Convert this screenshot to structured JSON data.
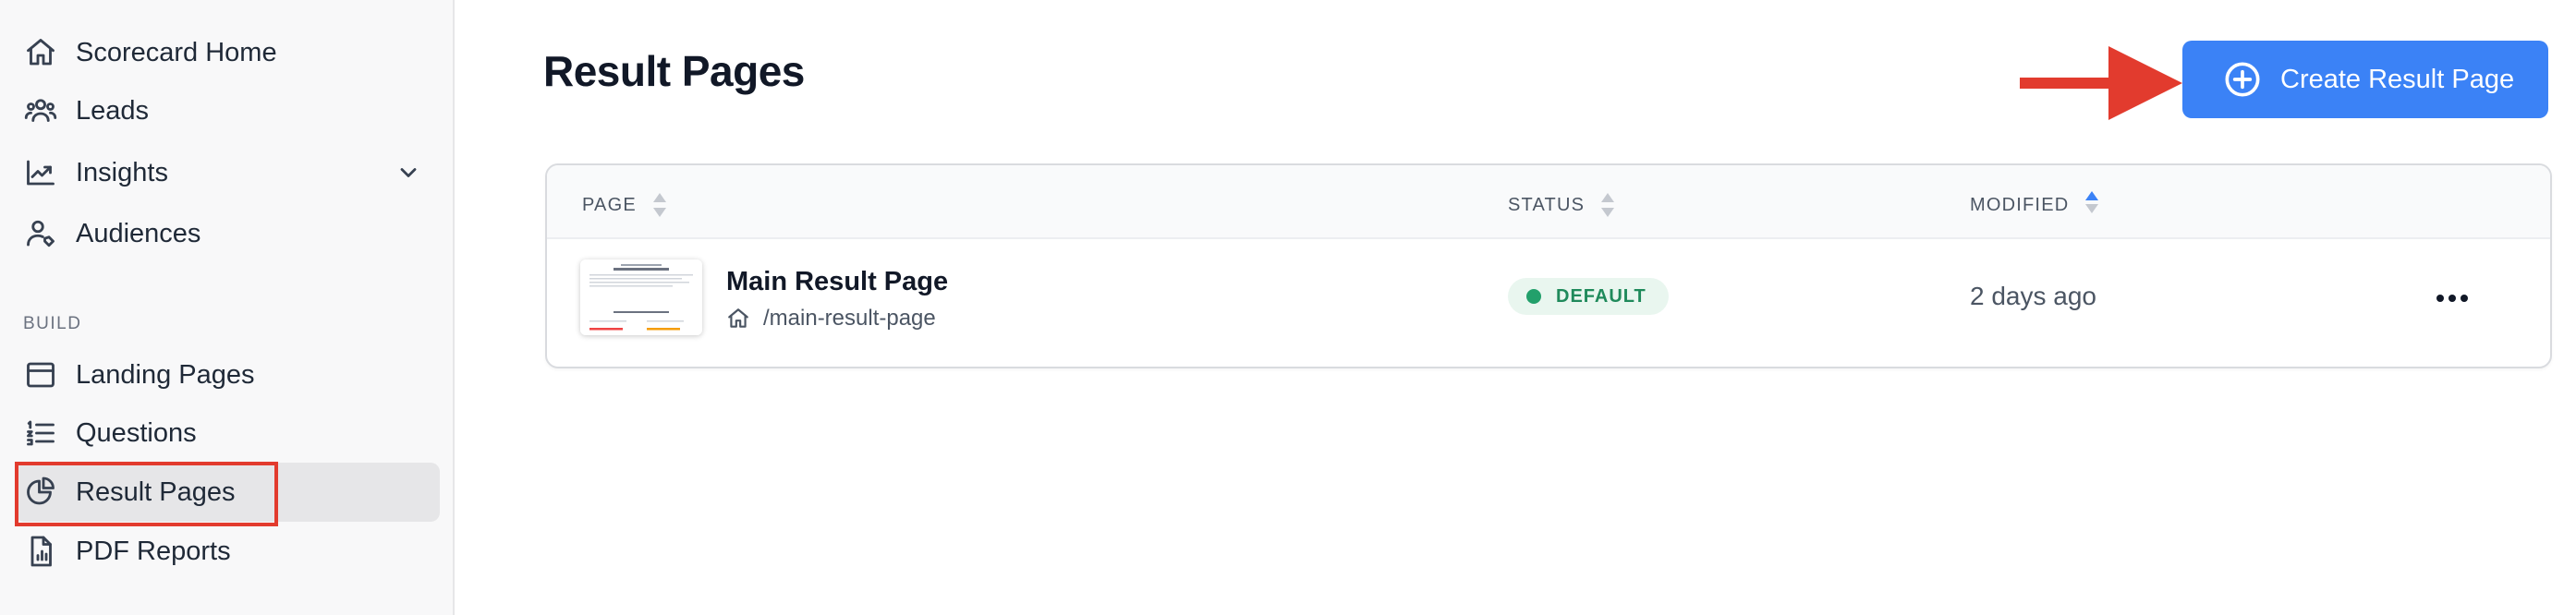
{
  "sidebar": {
    "items": [
      {
        "label": "Scorecard Home",
        "icon": "home-icon"
      },
      {
        "label": "Leads",
        "icon": "users-icon"
      },
      {
        "label": "Insights",
        "icon": "chart-line-icon"
      },
      {
        "label": "Audiences",
        "icon": "user-tag-icon"
      }
    ],
    "section_build": "BUILD",
    "build_items": [
      {
        "label": "Landing Pages",
        "icon": "browser-window-icon"
      },
      {
        "label": "Questions",
        "icon": "numbered-list-icon"
      },
      {
        "label": "Result Pages",
        "icon": "pie-chart-icon",
        "active": true
      },
      {
        "label": "PDF Reports",
        "icon": "document-chart-icon"
      }
    ]
  },
  "main": {
    "title": "Result Pages",
    "create_button": "Create Result Page"
  },
  "table": {
    "columns": [
      "PAGE",
      "STATUS",
      "MODIFIED"
    ],
    "rows": [
      {
        "name": "Main Result Page",
        "path": "/main-result-page",
        "status": "DEFAULT",
        "modified": "2 days ago"
      }
    ]
  },
  "colors": {
    "accent": "#3b82f6",
    "annotation": "#e23b2e",
    "status_default": "#22a06b"
  }
}
